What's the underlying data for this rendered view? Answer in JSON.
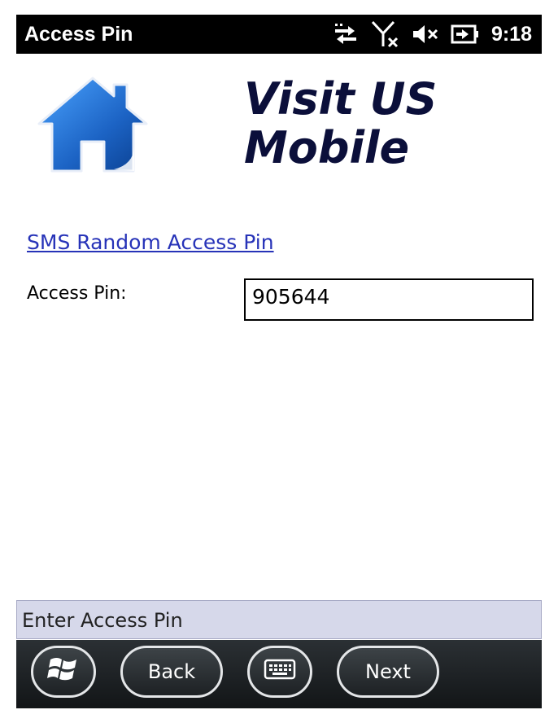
{
  "titlebar": {
    "title": "Access Pin",
    "time": "9:18",
    "icons": [
      "data-sync-icon",
      "no-signal-icon",
      "speaker-muted-icon",
      "battery-charging-icon"
    ]
  },
  "header": {
    "logo_icon": "house-icon",
    "brand_line1": "Visit US",
    "brand_line2": "Mobile"
  },
  "form": {
    "sms_link": "SMS Random Access Pin",
    "pin_label": "Access Pin:",
    "pin_value": "905644"
  },
  "hint": "Enter Access Pin",
  "softkeys": {
    "start_icon": "windows-logo-icon",
    "back": "Back",
    "keyboard_icon": "keyboard-icon",
    "next": "Next"
  },
  "colors": {
    "link": "#2733b8",
    "brand": "#0b0f3a",
    "hint_bg": "#d6d8ea",
    "house": "#1f6fc8"
  }
}
